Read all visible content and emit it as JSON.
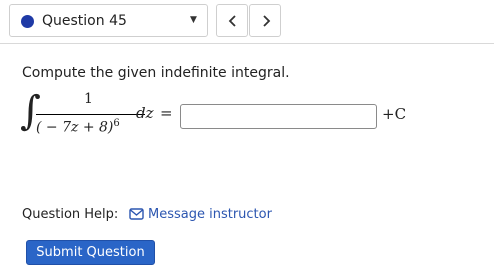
{
  "header": {
    "question_label": "Question 45",
    "dropdown_icon": "triangle-down-icon",
    "prev_icon": "chevron-left-icon",
    "next_icon": "chevron-right-icon"
  },
  "question": {
    "prompt": "Compute the given indefinite integral.",
    "integrand_numerator": "1",
    "integrand_denominator": "( − 7z + 8)",
    "integrand_exponent": "6",
    "differential": "dz",
    "equals": "=",
    "answer_value": "",
    "constant": "+C"
  },
  "help": {
    "label": "Question Help:",
    "link_label": "Message instructor",
    "link_icon": "envelope-icon"
  },
  "submit_label": "Submit Question",
  "colors": {
    "accent": "#2a65c7",
    "link": "#2c56b0",
    "question_dot": "#1f3aa6"
  }
}
